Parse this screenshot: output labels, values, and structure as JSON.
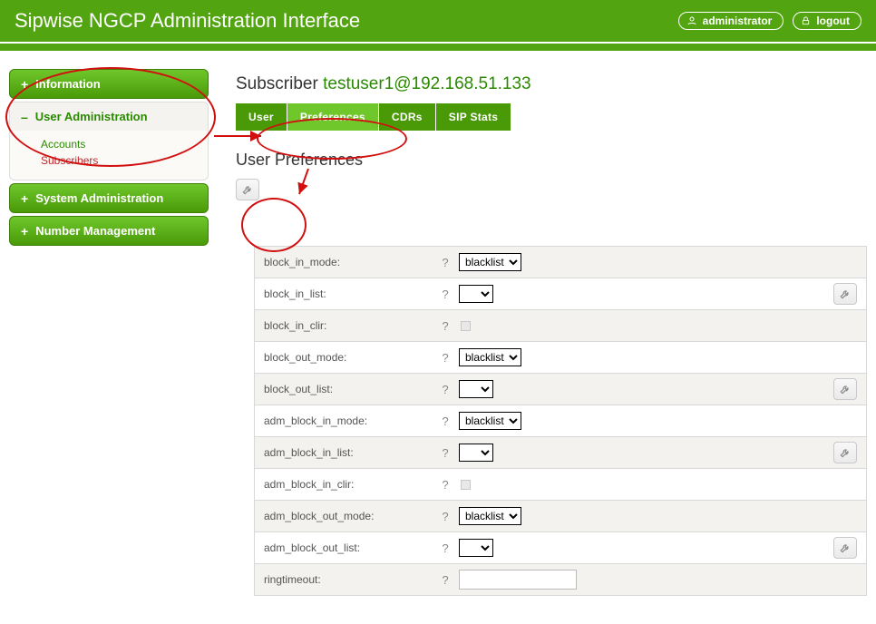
{
  "header": {
    "title": "Sipwise NGCP Administration Interface",
    "user_label": "administrator",
    "logout_label": "logout"
  },
  "sidebar": {
    "items": [
      {
        "label": "Information",
        "expanded": false
      },
      {
        "label": "User Administration",
        "expanded": true,
        "links": [
          {
            "label": "Accounts",
            "active": false
          },
          {
            "label": "Subscribers",
            "active": true
          }
        ]
      },
      {
        "label": "System Administration",
        "expanded": false
      },
      {
        "label": "Number Management",
        "expanded": false
      }
    ]
  },
  "main": {
    "subscriber_prefix": "Subscriber ",
    "subscriber_id": "testuser1@192.168.51.133",
    "tabs": [
      {
        "label": "User"
      },
      {
        "label": "Preferences",
        "active": true
      },
      {
        "label": "CDRs"
      },
      {
        "label": "SIP Stats"
      }
    ],
    "section_title": "User Preferences",
    "help_symbol": "?",
    "preferences": [
      {
        "key": "block_in_mode",
        "label": "block_in_mode:",
        "type": "select",
        "value": "blacklist",
        "action": false,
        "shade": true
      },
      {
        "key": "block_in_list",
        "label": "block_in_list:",
        "type": "select",
        "value": "",
        "action": true,
        "shade": false
      },
      {
        "key": "block_in_clir",
        "label": "block_in_clir:",
        "type": "checkbox",
        "value": false,
        "action": false,
        "shade": true
      },
      {
        "key": "block_out_mode",
        "label": "block_out_mode:",
        "type": "select",
        "value": "blacklist",
        "action": false,
        "shade": false
      },
      {
        "key": "block_out_list",
        "label": "block_out_list:",
        "type": "select",
        "value": "",
        "action": true,
        "shade": true
      },
      {
        "key": "adm_block_in_mode",
        "label": "adm_block_in_mode:",
        "type": "select",
        "value": "blacklist",
        "action": false,
        "shade": false
      },
      {
        "key": "adm_block_in_list",
        "label": "adm_block_in_list:",
        "type": "select",
        "value": "",
        "action": true,
        "shade": true
      },
      {
        "key": "adm_block_in_clir",
        "label": "adm_block_in_clir:",
        "type": "checkbox",
        "value": false,
        "action": false,
        "shade": false
      },
      {
        "key": "adm_block_out_mode",
        "label": "adm_block_out_mode:",
        "type": "select",
        "value": "blacklist",
        "action": false,
        "shade": true
      },
      {
        "key": "adm_block_out_list",
        "label": "adm_block_out_list:",
        "type": "select",
        "value": "",
        "action": true,
        "shade": false
      },
      {
        "key": "ringtimeout",
        "label": "ringtimeout:",
        "type": "text",
        "value": "",
        "action": false,
        "shade": true
      }
    ]
  }
}
